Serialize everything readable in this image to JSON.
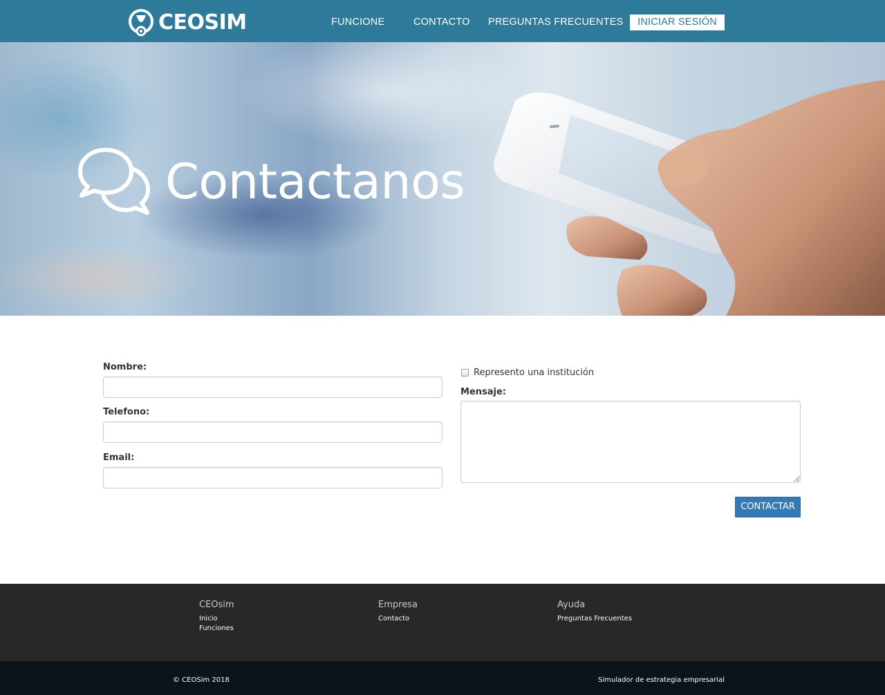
{
  "header": {
    "logo_text": "CEOSIM",
    "nav": {
      "funciones": "FUNCIONE",
      "contacto": "CONTACTO",
      "faq": "PREGUNTAS FRECUENTES"
    },
    "login_label": "INICIAR SESIÓN"
  },
  "hero": {
    "title": "Contactanos"
  },
  "form": {
    "nombre_label": "Nombre:",
    "nombre_value": "",
    "telefono_label": "Telefono:",
    "telefono_value": "",
    "email_label": "Email:",
    "email_value": "",
    "institucion_label": "Represento una institución",
    "institucion_checked": false,
    "mensaje_label": "Mensaje:",
    "mensaje_value": "",
    "submit_label": "CONTACTAR"
  },
  "footer": {
    "col1": {
      "heading": "CEOsim",
      "links": [
        "Inicio",
        "Funciones"
      ]
    },
    "col2": {
      "heading": "Empresa",
      "links": [
        "Contacto"
      ]
    },
    "col3": {
      "heading": "Ayuda",
      "links": [
        "Preguntas Frecuentes"
      ]
    },
    "copyright": "© CEOSim 2018",
    "tagline": "Simulador de estrategia empresarial"
  },
  "colors": {
    "header_bg": "#2e7a9a",
    "button_primary": "#337ab7",
    "footer_bg": "#282828",
    "bottom_bar_bg": "#0c1319"
  }
}
